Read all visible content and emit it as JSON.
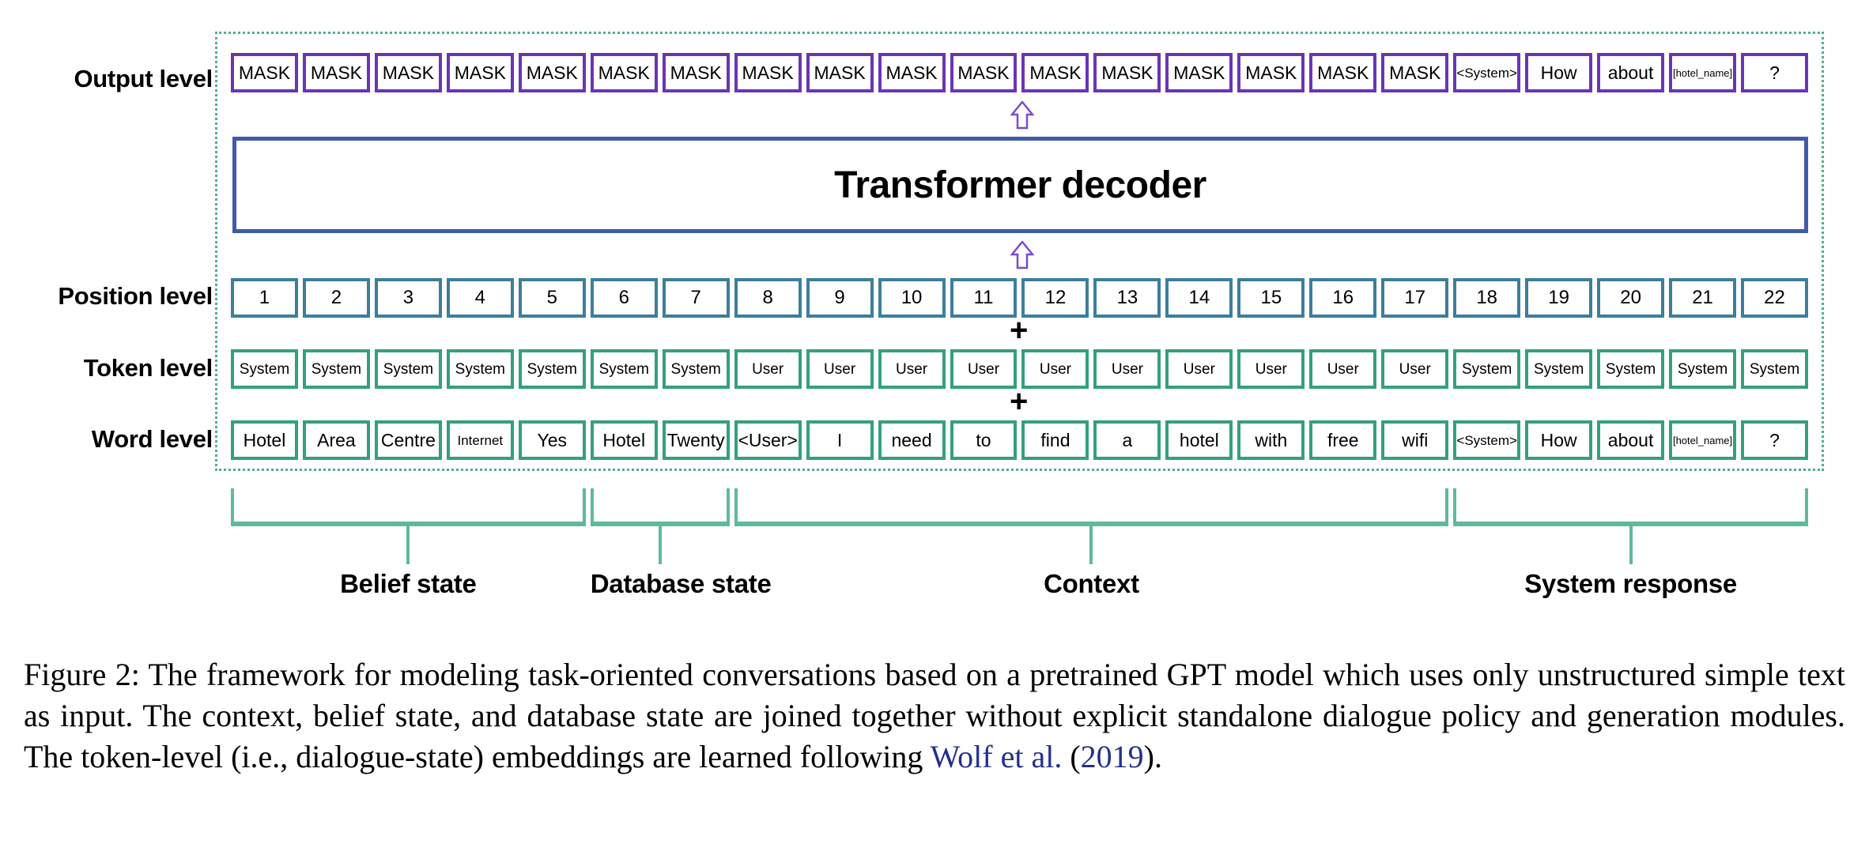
{
  "figure": {
    "row_labels": {
      "output": "Output level",
      "position": "Position level",
      "token": "Token level",
      "word": "Word level"
    },
    "decoder": {
      "title": "Transformer decoder"
    },
    "operators": {
      "plus": "+",
      "arrow": "up-arrow"
    },
    "colors": {
      "output_border": "#6a35b5",
      "position_border": "#3c7e9c",
      "token_border": "#34a07d",
      "word_border": "#34a07d",
      "decoder_border": "#3f5ba9",
      "frame_dotted": "#4fae8e",
      "bracket": "#5fba99",
      "citation_link": "#24308c"
    },
    "output_level": [
      "MASK",
      "MASK",
      "MASK",
      "MASK",
      "MASK",
      "MASK",
      "MASK",
      "MASK",
      "MASK",
      "MASK",
      "MASK",
      "MASK",
      "MASK",
      "MASK",
      "MASK",
      "MASK",
      "MASK",
      "<System>",
      "How",
      "about",
      "[hotel_name]",
      "?"
    ],
    "position_level": [
      "1",
      "2",
      "3",
      "4",
      "5",
      "6",
      "7",
      "8",
      "9",
      "10",
      "11",
      "12",
      "13",
      "14",
      "15",
      "16",
      "17",
      "18",
      "19",
      "20",
      "21",
      "22"
    ],
    "token_level": [
      "System",
      "System",
      "System",
      "System",
      "System",
      "System",
      "System",
      "User",
      "User",
      "User",
      "User",
      "User",
      "User",
      "User",
      "User",
      "User",
      "User",
      "System",
      "System",
      "System",
      "System",
      "System"
    ],
    "word_level": [
      "Hotel",
      "Area",
      "Centre",
      "Internet",
      "Yes",
      "Hotel",
      "Twenty",
      "<User>",
      "I",
      "need",
      "to",
      "find",
      "a",
      "hotel",
      "with",
      "free",
      "wifi",
      "<System>",
      "How",
      "about",
      "[hotel_name]",
      "?"
    ],
    "groups": [
      {
        "label": "Belief state",
        "start": 0,
        "end": 4
      },
      {
        "label": "Database state",
        "start": 5,
        "end": 6
      },
      {
        "label": "Context",
        "start": 7,
        "end": 16
      },
      {
        "label": "System response",
        "start": 17,
        "end": 21
      }
    ]
  },
  "caption": {
    "part1": "Figure 2: The framework for modeling task-oriented conversations based on a pretrained GPT model which uses only unstructured simple text as input.  The context, belief state, and database state are joined together without explicit standalone dialogue policy and generation modules. The token-level (i.e., dialogue-state) embeddings are learned following ",
    "cite_author": "Wolf et al.",
    "mid": " (",
    "cite_year": "2019",
    "part2": ")."
  }
}
